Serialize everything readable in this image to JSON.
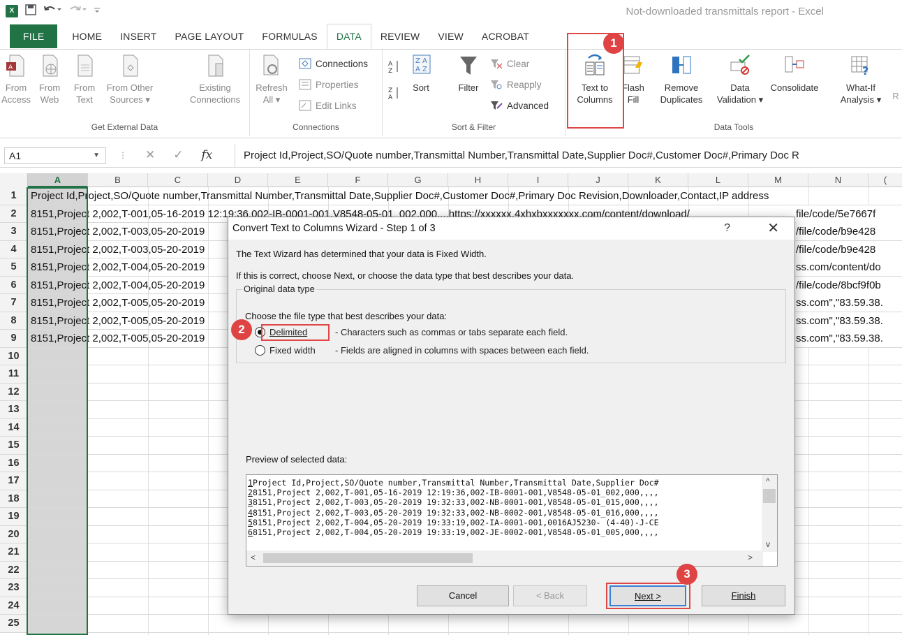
{
  "window": {
    "title": "Not-downloaded transmittals report - Excel"
  },
  "tabs": [
    "FILE",
    "HOME",
    "INSERT",
    "PAGE LAYOUT",
    "FORMULAS",
    "DATA",
    "REVIEW",
    "VIEW",
    "ACROBAT"
  ],
  "ribbon": {
    "get_external": {
      "label": "Get External Data",
      "from_access": [
        "From",
        "Access"
      ],
      "from_web": [
        "From",
        "Web"
      ],
      "from_text": [
        "From",
        "Text"
      ],
      "from_other": [
        "From Other",
        "Sources ▾"
      ],
      "existing": [
        "Existing",
        "Connections"
      ]
    },
    "connections": {
      "label": "Connections",
      "refresh": [
        "Refresh",
        "All ▾"
      ],
      "connections": "Connections",
      "properties": "Properties",
      "edit_links": "Edit Links"
    },
    "sort_filter": {
      "label": "Sort & Filter",
      "sort": "Sort",
      "filter": "Filter",
      "clear": "Clear",
      "reapply": "Reapply",
      "advanced": "Advanced"
    },
    "data_tools": {
      "label": "Data Tools",
      "text_to_columns": [
        "Text to",
        "Columns"
      ],
      "flash_fill": [
        "Flash",
        "Fill"
      ],
      "remove_duplicates": [
        "Remove",
        "Duplicates"
      ],
      "data_validation": [
        "Data",
        "Validation ▾"
      ],
      "consolidate": "Consolidate",
      "what_if": [
        "What-If",
        "Analysis ▾"
      ],
      "cut_off": "R"
    }
  },
  "badges": {
    "b1": "1",
    "b2": "2",
    "b3": "3"
  },
  "formula_bar": {
    "name_box": "A1",
    "fx": "fx",
    "content": "Project Id,Project,SO/Quote number,Transmittal Number,Transmittal Date,Supplier Doc#,Customer Doc#,Primary Doc R"
  },
  "grid": {
    "columns": [
      "A",
      "B",
      "C",
      "D",
      "E",
      "F",
      "G",
      "H",
      "I",
      "J",
      "K",
      "L",
      "M",
      "N",
      "("
    ],
    "rows": [
      {
        "n": "1",
        "left": "Project Id,Project,SO/Quote number,Transmittal Number,Transmittal Date,Supplier Doc#,Customer Doc#,Primary Doc Revision,Downloader,Contact,IP address",
        "right": ""
      },
      {
        "n": "2",
        "left": "8151,Project 2,002,T-001,05-16-2019 12:19:36,002-IB-0001-001,V8548-05-01_002,000,,,,https://xxxxxx.4xhxbxxxxxxx.com/content/download/",
        "right": "file/code/5e7667f"
      },
      {
        "n": "3",
        "left": "8151,Project 2,002,T-003,05-20-2019",
        "right": "/file/code/b9e428"
      },
      {
        "n": "4",
        "left": "8151,Project 2,002,T-003,05-20-2019",
        "right": "/file/code/b9e428"
      },
      {
        "n": "5",
        "left": "8151,Project 2,002,T-004,05-20-2019",
        "right": "ss.com/content/do"
      },
      {
        "n": "6",
        "left": "8151,Project 2,002,T-004,05-20-2019",
        "right": "/file/code/8bcf9f0b"
      },
      {
        "n": "7",
        "left": "8151,Project 2,002,T-005,05-20-2019",
        "right": "ss.com\",\"83.59.38."
      },
      {
        "n": "8",
        "left": "8151,Project 2,002,T-005,05-20-2019",
        "right": "ss.com\",\"83.59.38."
      },
      {
        "n": "9",
        "left": "8151,Project 2,002,T-005,05-20-2019",
        "right": "ss.com\",\"83.59.38."
      },
      {
        "n": "10"
      },
      {
        "n": "11"
      },
      {
        "n": "12"
      },
      {
        "n": "13"
      },
      {
        "n": "14"
      },
      {
        "n": "15"
      },
      {
        "n": "16"
      },
      {
        "n": "17"
      },
      {
        "n": "18"
      },
      {
        "n": "19"
      },
      {
        "n": "20"
      },
      {
        "n": "21"
      },
      {
        "n": "22"
      },
      {
        "n": "23"
      },
      {
        "n": "24"
      },
      {
        "n": "25"
      }
    ]
  },
  "dialog": {
    "title": "Convert Text to Columns Wizard - Step 1 of 3",
    "help": "?",
    "close": "✕",
    "line1": "The Text Wizard has determined that your data is Fixed Width.",
    "line2": "If this is correct, choose Next, or choose the data type that best describes your data.",
    "group_label": "Original data type",
    "choose_label": "Choose the file type that best describes your data:",
    "delimited_label": "Delimited",
    "delimited_desc": "- Characters such as commas or tabs separate each field.",
    "fixed_label": "Fixed width",
    "fixed_desc": "- Fields are aligned in columns with spaces between each field.",
    "preview_label": "Preview of selected data:",
    "preview_lines": [
      [
        "1",
        "Project Id,Project,SO/Quote number,Transmittal Number,Transmittal Date,Supplier Doc#"
      ],
      [
        "2",
        "8151,Project 2,002,T-001,05-16-2019 12:19:36,002-IB-0001-001,V8548-05-01_002,000,,,,"
      ],
      [
        "3",
        "8151,Project 2,002,T-003,05-20-2019 19:32:33,002-NB-0001-001,V8548-05-01_015,000,,,,"
      ],
      [
        "4",
        "8151,Project 2,002,T-003,05-20-2019 19:32:33,002-NB-0002-001,V8548-05-01_016,000,,,,"
      ],
      [
        "5",
        "8151,Project 2,002,T-004,05-20-2019 19:33:19,002-IA-0001-001,0016AJ5230- (4-40)-J-CE"
      ],
      [
        "6",
        "8151,Project 2,002,T-004,05-20-2019 19:33:19,002-JE-0002-001,V8548-05-01_005,000,,,,"
      ]
    ],
    "buttons": {
      "cancel": "Cancel",
      "back": "< Back",
      "next": "Next >",
      "finish": "Finish"
    }
  },
  "colors": {
    "excel_green": "#217346",
    "highlight_red": "#e04646",
    "badge_red": "#df4343"
  }
}
